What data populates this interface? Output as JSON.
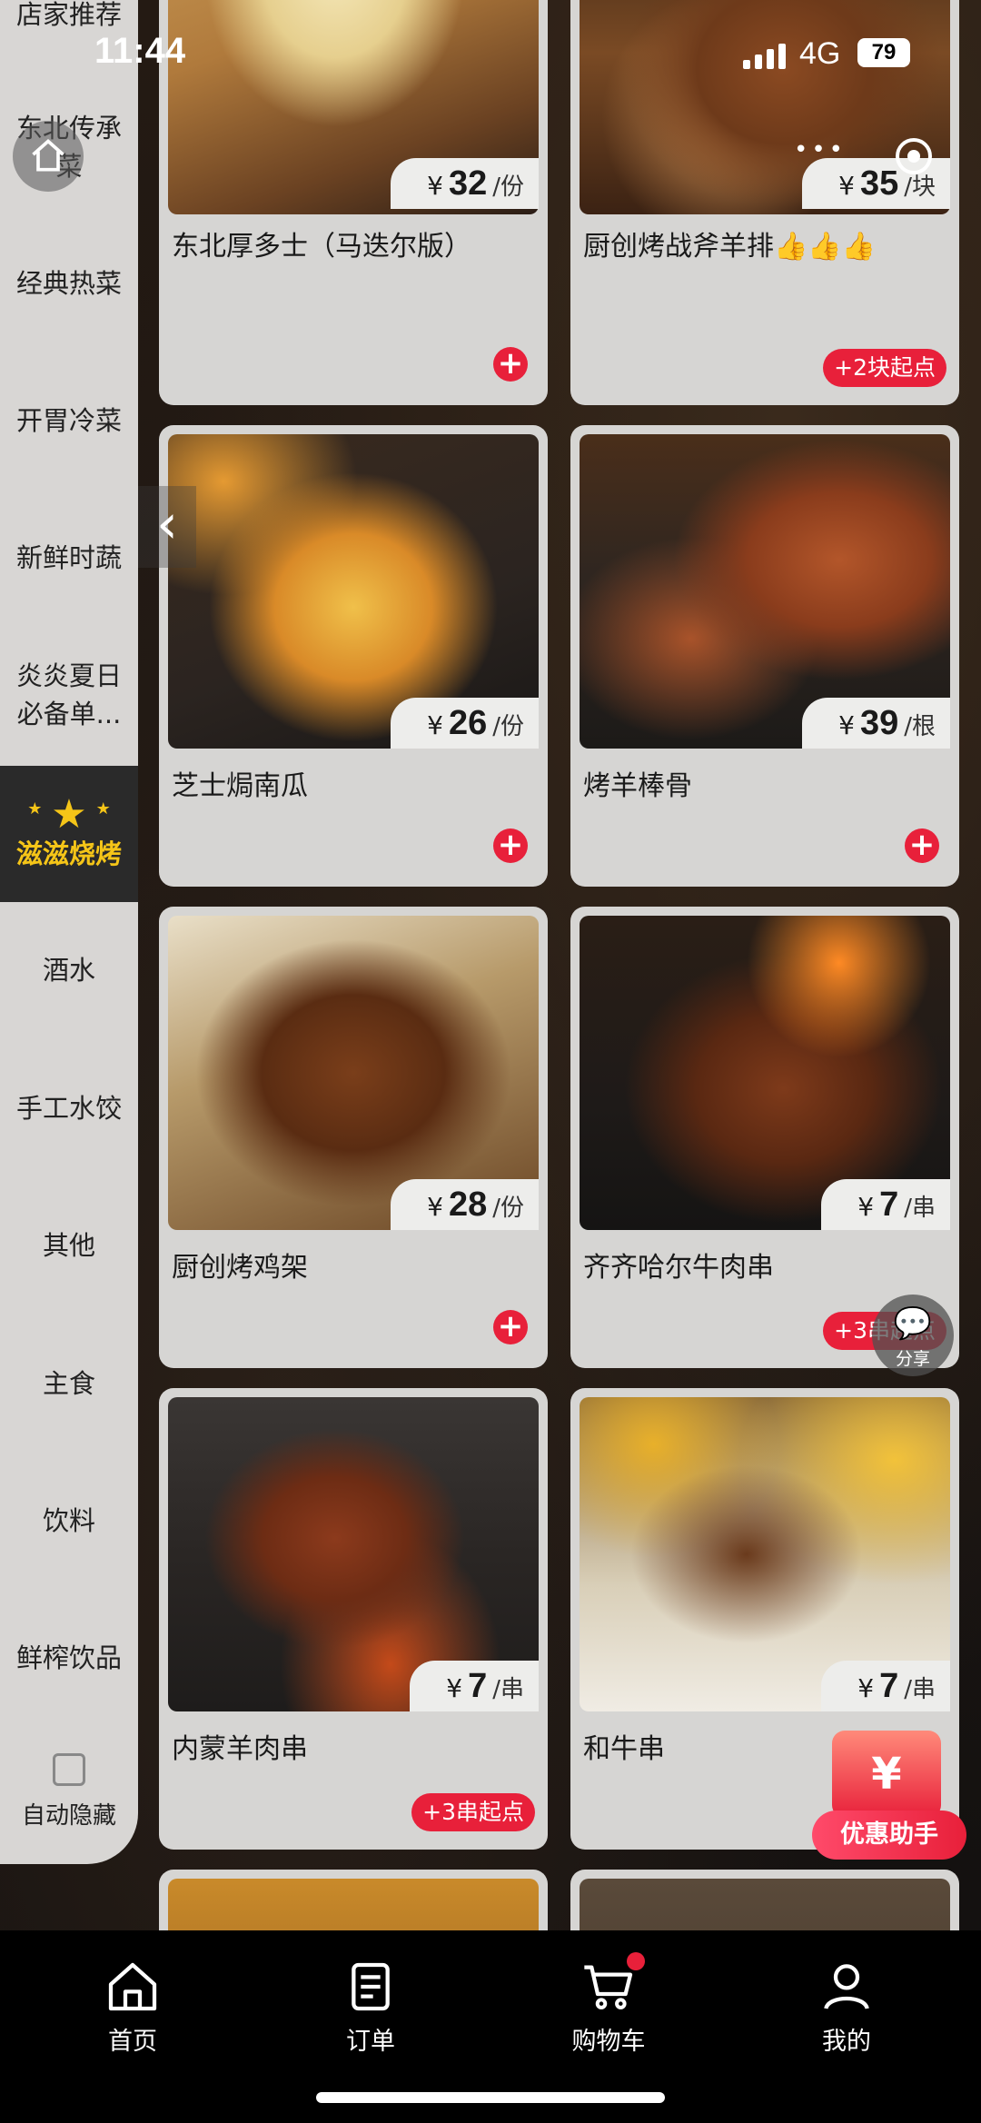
{
  "status_bar": {
    "time": "11:44",
    "network": "4G",
    "battery": "79"
  },
  "sidebar": {
    "items": [
      {
        "label": "店家推荐"
      },
      {
        "label": "东北传承菜"
      },
      {
        "label": "经典热菜"
      },
      {
        "label": "开胃冷菜"
      },
      {
        "label": "新鲜时蔬"
      },
      {
        "label": "炎炎夏日必备单..."
      },
      {
        "label": "滋滋烧烤",
        "active": true
      },
      {
        "label": "酒水"
      },
      {
        "label": "手工水饺"
      },
      {
        "label": "其他"
      },
      {
        "label": "主食"
      },
      {
        "label": "饮料"
      },
      {
        "label": "鲜榨饮品"
      }
    ],
    "auto_hide_label": "自动隐藏"
  },
  "products": [
    {
      "name": "东北厚多士（马迭尔版）",
      "currency": "¥",
      "price": "32",
      "unit": "/份",
      "image": "toast",
      "action": "add"
    },
    {
      "name": "厨创烤战斧羊排👍👍👍",
      "currency": "¥",
      "price": "35",
      "unit": "/块",
      "image": "lamb-chop",
      "action": "min",
      "min_label": "+2块起点"
    },
    {
      "name": "芝士焗南瓜",
      "currency": "¥",
      "price": "26",
      "unit": "/份",
      "image": "cheese-pumpkin",
      "action": "add"
    },
    {
      "name": "烤羊棒骨",
      "currency": "¥",
      "price": "39",
      "unit": "/根",
      "image": "lamb-leg",
      "action": "add"
    },
    {
      "name": "厨创烤鸡架",
      "currency": "¥",
      "price": "28",
      "unit": "/份",
      "image": "chicken-rack",
      "action": "add"
    },
    {
      "name": "齐齐哈尔牛肉串",
      "currency": "¥",
      "price": "7",
      "unit": "/串",
      "image": "beef-skewer",
      "action": "min",
      "min_label": "+3串起点"
    },
    {
      "name": "内蒙羊肉串",
      "currency": "¥",
      "price": "7",
      "unit": "/串",
      "image": "mutton-skewer",
      "action": "min",
      "min_label": "+3串起点"
    },
    {
      "name": "和牛串",
      "currency": "¥",
      "price": "7",
      "unit": "/串",
      "image": "wagyu-skewer",
      "action": "none"
    }
  ],
  "floating": {
    "share_label": "分享",
    "coupon_symbol": "¥",
    "coupon_label": "优惠助手"
  },
  "tab_bar": {
    "items": [
      {
        "label": "首页",
        "icon": "home-icon"
      },
      {
        "label": "订单",
        "icon": "order-icon"
      },
      {
        "label": "购物车",
        "icon": "cart-icon"
      },
      {
        "label": "我的",
        "icon": "user-icon"
      }
    ]
  },
  "colors": {
    "accent_red": "#e8203a",
    "active_category": "#f5c518"
  }
}
